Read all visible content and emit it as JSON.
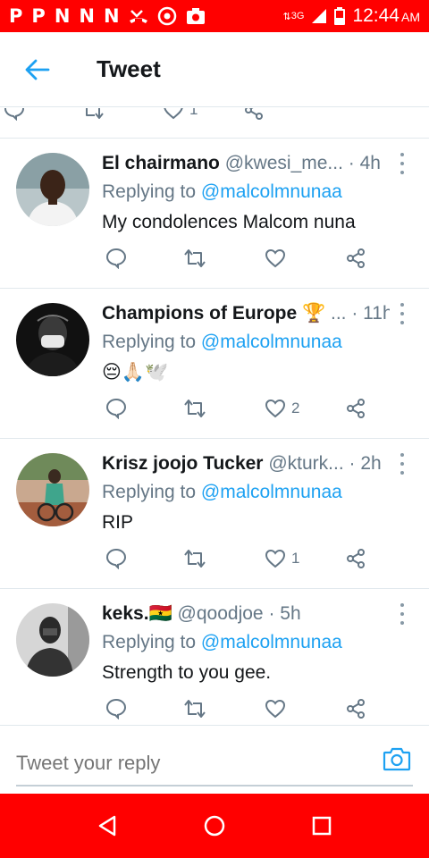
{
  "status_bar": {
    "icons": [
      "P",
      "P",
      "N",
      "N",
      "N"
    ],
    "network": "3G",
    "time": "12:44",
    "ampm": "AM"
  },
  "header": {
    "title": "Tweet"
  },
  "top_partial": {
    "likes": "1"
  },
  "tweets": [
    {
      "name": "El chairmano",
      "handle": "@kwesi_me...",
      "time": "· 4h",
      "replying_prefix": "Replying to",
      "replying_to": "@malcolmnunaa",
      "text": "My condolences Malcom nuna",
      "retweets": "",
      "likes": ""
    },
    {
      "name": "Champions of Europe 🏆",
      "handle": "...",
      "time": "· 11h",
      "replying_prefix": "Replying to",
      "replying_to": "@malcolmnunaa",
      "text": "😔🙏🏻🕊️",
      "retweets": "",
      "likes": "2"
    },
    {
      "name": "Krisz joojo Tucker",
      "handle": "@kturk...",
      "time": "· 2h",
      "replying_prefix": "Replying to",
      "replying_to": "@malcolmnunaa",
      "text": "RIP",
      "retweets": "",
      "likes": "1"
    },
    {
      "name": "keks.🇬🇭",
      "handle": "@qoodjoe",
      "time": "· 5h",
      "replying_prefix": "Replying to",
      "replying_to": "@malcolmnunaa",
      "text": "Strength to you gee.",
      "retweets": "",
      "likes": ""
    }
  ],
  "reply_box": {
    "placeholder": "Tweet your reply"
  },
  "colors": {
    "accent": "#1da1f2",
    "status_bar": "#ff0000",
    "secondary_text": "#657786",
    "divider": "#e1e8ed"
  }
}
